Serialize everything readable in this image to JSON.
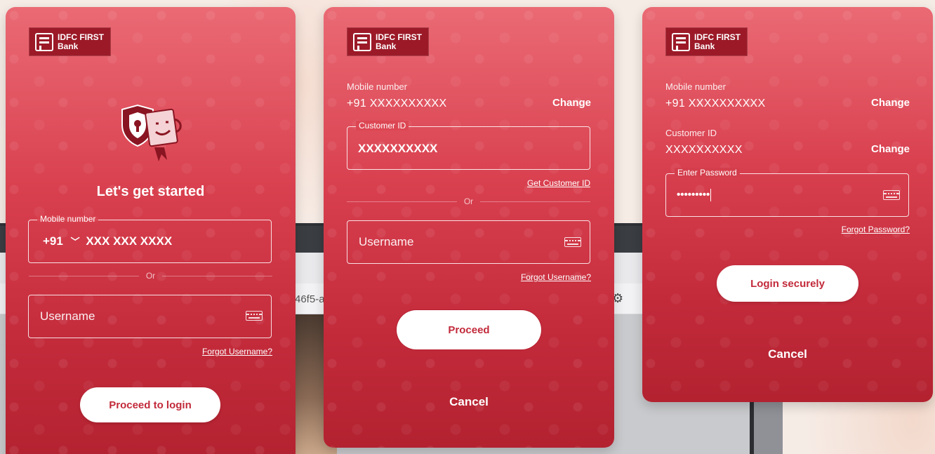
{
  "brand": {
    "line1": "IDFC FIRST",
    "line2": "Bank"
  },
  "screen1": {
    "heading": "Let's get started",
    "mobile_label": "Mobile number",
    "country_code": "+91",
    "mobile_placeholder": "XXX XXX XXXX",
    "or_text": "Or",
    "username_placeholder": "Username",
    "forgot_username": "Forgot Username?",
    "proceed_label": "Proceed to login"
  },
  "screen2": {
    "mobile_label": "Mobile number",
    "mobile_value": "+91 XXXXXXXXXX",
    "change_label": "Change",
    "customer_id_label": "Customer ID",
    "customer_id_value": "XXXXXXXXXX",
    "get_customer_id": "Get Customer ID",
    "or_text": "Or",
    "username_placeholder": "Username",
    "forgot_username": "Forgot Username?",
    "proceed_label": "Proceed",
    "cancel_label": "Cancel"
  },
  "screen3": {
    "mobile_label": "Mobile number",
    "mobile_value": "+91 XXXXXXXXXX",
    "change_mobile_label": "Change",
    "customer_id_label": "Customer ID",
    "customer_id_value": "XXXXXXXXXX",
    "change_customer_id_label": "Change",
    "password_label": "Enter Password",
    "password_value": "•••••••••",
    "forgot_password": "Forgot Password?",
    "login_label": "Login securely",
    "cancel_label": "Cancel"
  },
  "background": {
    "url_fragment": "46f5-a"
  },
  "colors": {
    "card_top": "#ea6a74",
    "card_bottom": "#b32230",
    "button_bg": "#ffffff",
    "button_text": "#c22a3a",
    "logo_bg": "#9c1a28"
  },
  "icons": [
    "bank-logo-icon",
    "security-shield-icon",
    "chevron-down-icon",
    "keyboard-icon",
    "gear-icon"
  ]
}
